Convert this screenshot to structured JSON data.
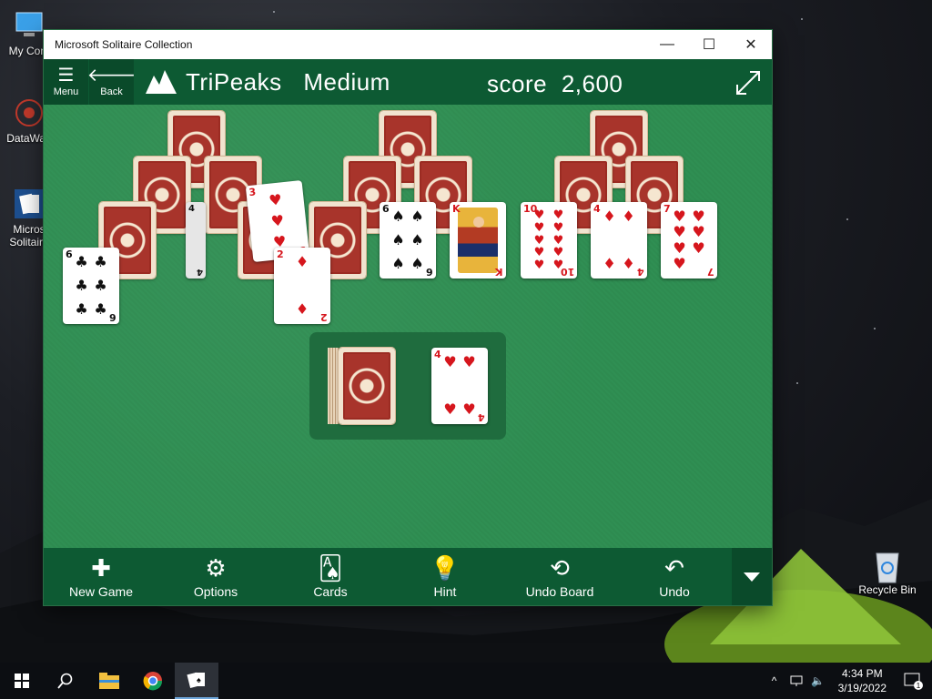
{
  "desktop": {
    "icons": [
      {
        "label": "My Com",
        "icon": "computer-icon"
      },
      {
        "label": "DataWag",
        "icon": "datawag-icon"
      },
      {
        "label": "Micros",
        "label2": "Solitaire",
        "icon": "solitaire-icon"
      },
      {
        "label": "Recycle Bin",
        "icon": "recycle-bin-icon"
      }
    ]
  },
  "window": {
    "title": "Microsoft Solitaire Collection",
    "controls": {
      "minimize": "—",
      "maximize": "☐",
      "close": "✕"
    }
  },
  "appbar": {
    "menu_label": "Menu",
    "back_label": "Back",
    "game_name": "TriPeaks",
    "difficulty": "Medium",
    "score_label": "score",
    "score_value": "2,600"
  },
  "cards": {
    "c1": {
      "rank": "6",
      "suit": "♣"
    },
    "c2": {
      "rank": "4",
      "suit": "♠"
    },
    "c3": {
      "rank": "3",
      "suit": "♥"
    },
    "c4": {
      "rank": "2",
      "suit": "♦"
    },
    "c5": {
      "rank": "6",
      "suit": "♠"
    },
    "c6": {
      "rank": "K",
      "suit": "♦"
    },
    "c7": {
      "rank": "10",
      "suit": "♥"
    },
    "c8": {
      "rank": "4",
      "suit": "♦"
    },
    "c9": {
      "rank": "7",
      "suit": "♥"
    },
    "waste": {
      "rank": "4",
      "suit": "♥"
    }
  },
  "toolbar": {
    "new_game": "New Game",
    "options": "Options",
    "cards": "Cards",
    "hint": "Hint",
    "undo_board": "Undo Board",
    "undo": "Undo"
  },
  "taskbar": {
    "time": "4:34 PM",
    "date": "3/19/2022",
    "notifications": "1"
  },
  "colors": {
    "felt": "#2f8f53",
    "bar": "#0d5a33",
    "red_suit": "#d6161d"
  }
}
